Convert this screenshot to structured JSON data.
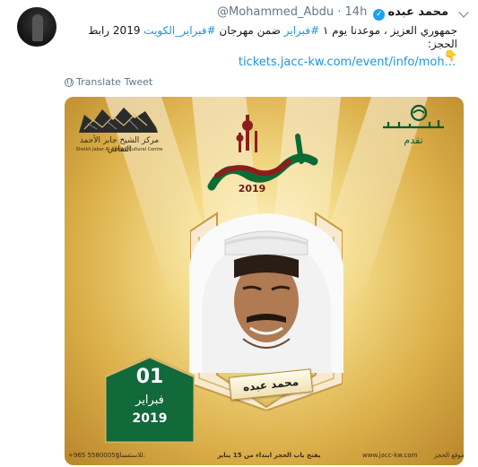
{
  "tweet": {
    "author_name": "محمد عبده",
    "handle": "@Mohammed_Abdu",
    "separator": "·",
    "time": "14h",
    "text_part1": "جمهوري العزيز ، موعدنا يوم ١ ",
    "hashtag1": "#فبراير",
    "text_part2": " ضمن مهرجان ",
    "hashtag2": "#فبراير_الكويت",
    "text_part3": " 2019 رابط الحجز:",
    "emoji": "👇",
    "link": "tickets.jacc-kw.com/event/info/moh...",
    "translate_label": "Translate Tweet"
  },
  "poster": {
    "centre_name_ar": "مركز الشيخ جابر الأحمد الثقافي",
    "centre_name_en": "Sheikh Jaber Al-Ahmad Cultural Centre",
    "presents": "تقدم",
    "festival_title": "فبراير الكويت",
    "festival_year": "2019",
    "singer_name": "محمد عبده",
    "date_day": "01",
    "date_month": "فبراير",
    "date_year": "2019",
    "footer_phone": "+965 55800058",
    "footer_phone_label": "للاستفسار:",
    "footer_open": "يفتح باب الحجز ابتداء من 15 يناير",
    "footer_site": "www.jacc-kw.com",
    "footer_site_label": "موقع الحجز:"
  },
  "colors": {
    "link_blue": "#1b95e0",
    "verified_blue": "#1da1f2",
    "poster_gold": "#dcb04a",
    "badge_green": "#12693a"
  },
  "icons": [
    "verified-badge-icon",
    "chevron-down-icon",
    "globe-icon",
    "jacc-building-logo",
    "rotana-logo"
  ]
}
